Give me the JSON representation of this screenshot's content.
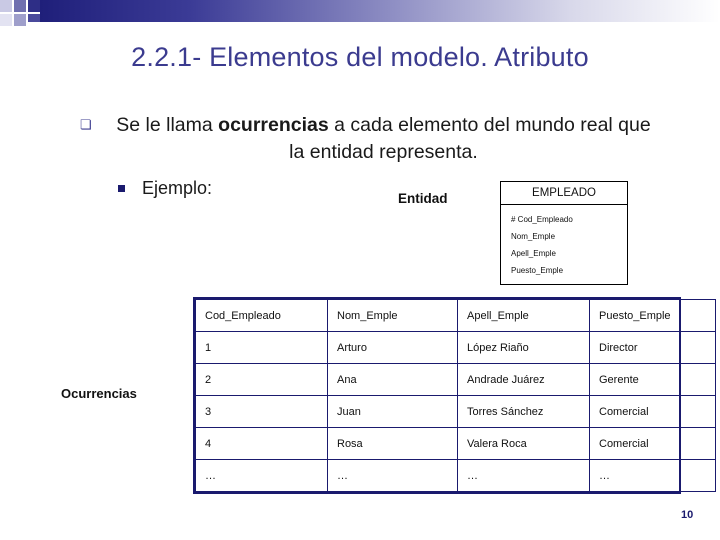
{
  "slide": {
    "title": "2.2.1- Elementos del modelo. Atributo",
    "page_number": "10",
    "bullet1": {
      "marker": "¡",
      "text_before": "Se le llama ",
      "text_bold": "ocurrencias",
      "text_after": " a cada elemento del mundo real que la entidad representa."
    },
    "bullet2": {
      "text": "Ejemplo:"
    },
    "entidad_label": "Entidad",
    "ocurrencias_label": "Ocurrencias"
  },
  "entity_box": {
    "name": "EMPLEADO",
    "attributes": [
      "# Cod_Empleado",
      "Nom_Emple",
      "Apell_Emple",
      "Puesto_Emple"
    ]
  },
  "data_table": {
    "headers": [
      "Cod_Empleado",
      "Nom_Emple",
      "Apell_Emple",
      "Puesto_Emple"
    ],
    "rows": [
      [
        "1",
        "Arturo",
        "López Riaño",
        "Director"
      ],
      [
        "2",
        "Ana",
        "Andrade Juárez",
        "Gerente"
      ],
      [
        "3",
        "Juan",
        "Torres Sánchez",
        "Comercial"
      ],
      [
        "4",
        "Rosa",
        "Valera Roca",
        "Comercial"
      ],
      [
        "…",
        "…",
        "…",
        "…"
      ]
    ]
  },
  "colors": {
    "title": "#3b3b8f",
    "accent_dark": "#1a1a6e",
    "table_border": "#1a1a6e"
  }
}
